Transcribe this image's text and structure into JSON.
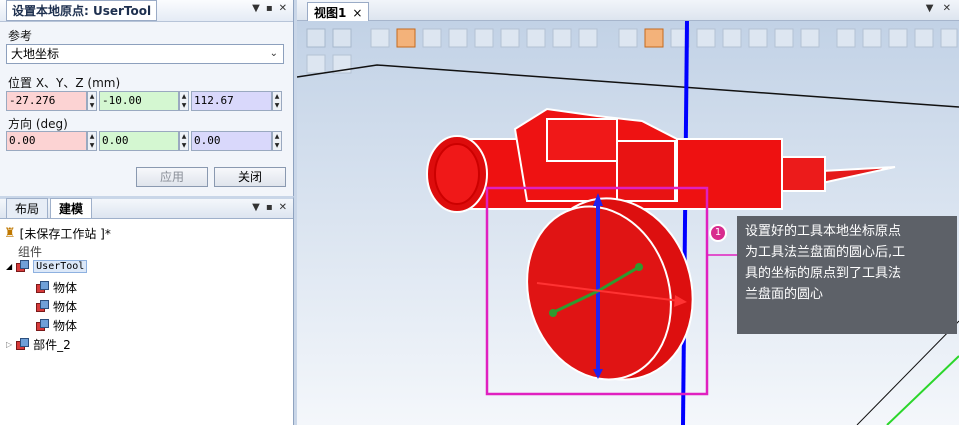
{
  "top_panel": {
    "title": "设置本地原点: UserTool",
    "reference_label": "参考",
    "reference_value": "大地坐标",
    "position_label": "位置 X、Y、Z (mm)",
    "pos_x": "-27.276",
    "pos_y": "-10.00",
    "pos_z": "112.67",
    "orientation_label": "方向 (deg)",
    "rot_x": "0.00",
    "rot_y": "0.00",
    "rot_z": "0.00",
    "apply_label": "应用",
    "close_label": "关闭"
  },
  "bottom_panel": {
    "tabs": [
      "布局",
      "建模"
    ],
    "station": "[未保存工作站 ]*",
    "group": "组件",
    "tool": "UserTool",
    "bodies": [
      "物体",
      "物体",
      "物体"
    ],
    "part": "部件_2"
  },
  "viewport": {
    "tab_label": "视图1",
    "tab_close": "×",
    "callout_number": "1",
    "callout_lines": [
      "设置好的工具本地坐标原点",
      "为工具法兰盘面的圆心后,工",
      "具的坐标的原点到了工具法",
      "兰盘面的圆心"
    ]
  },
  "colors": {
    "tool_red": "#ee1111",
    "highlight_magenta": "#e020c0",
    "z_axis_blue": "#0000ff"
  }
}
